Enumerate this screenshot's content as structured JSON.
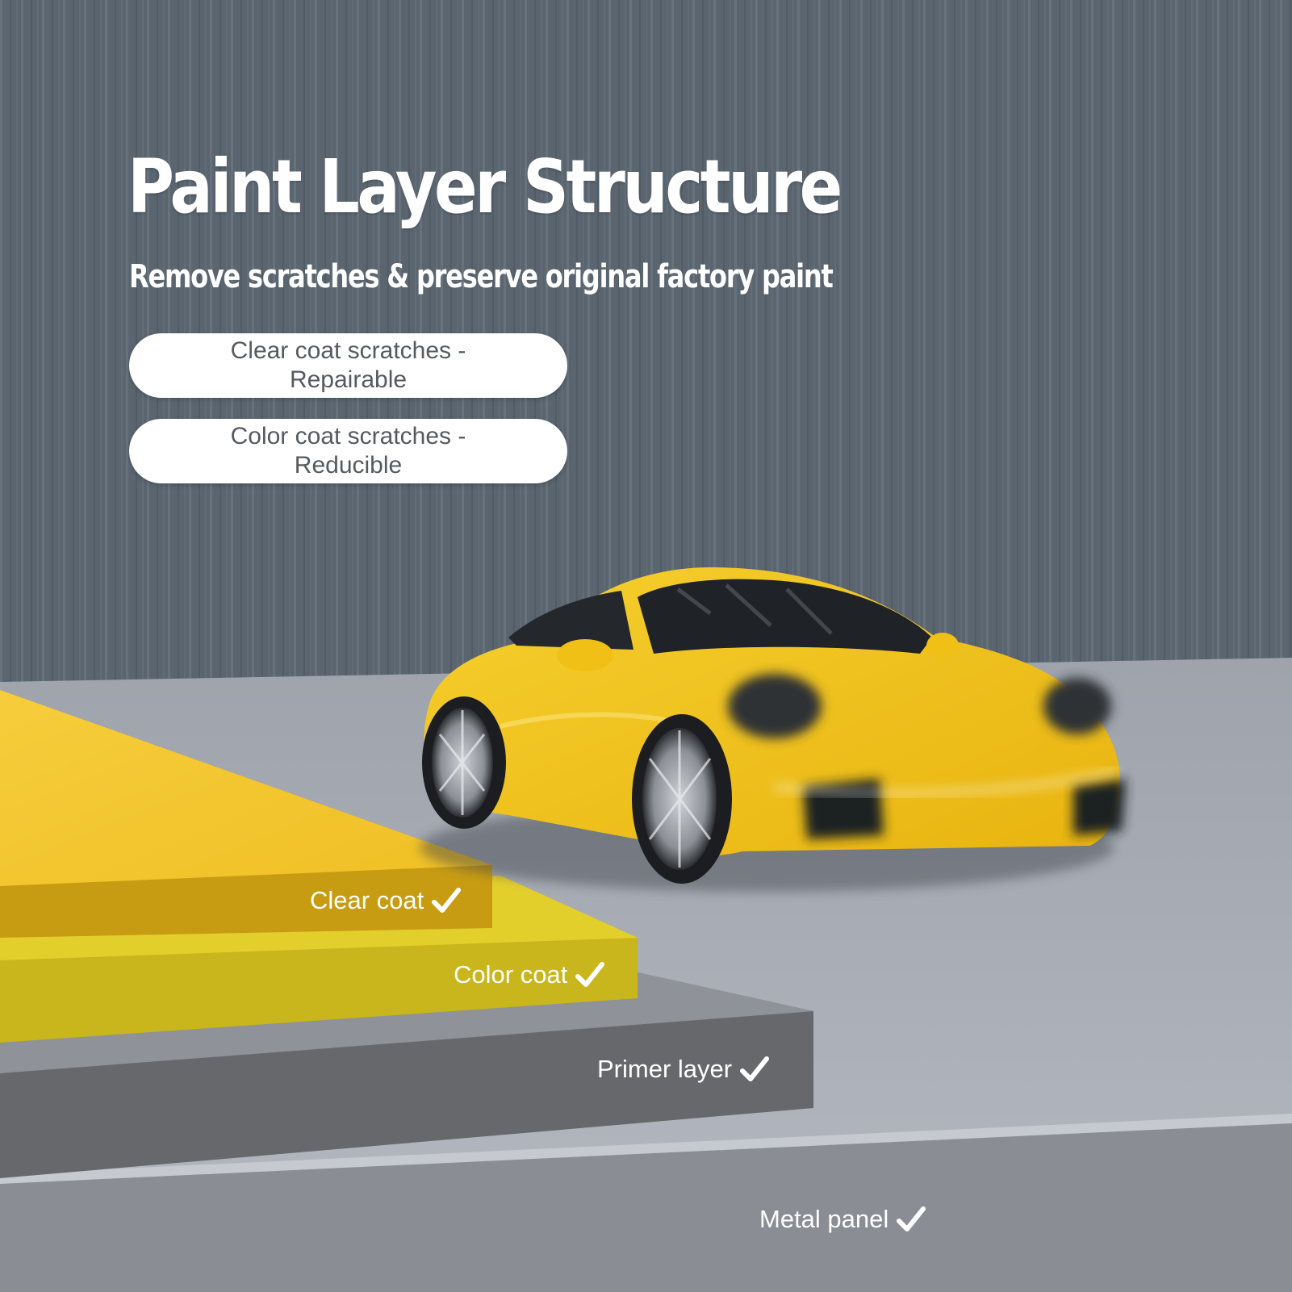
{
  "header": {
    "title": "Paint Layer Structure",
    "subtitle": "Remove scratches & preserve original factory paint"
  },
  "pills": [
    {
      "text": "Clear coat scratches - Repairable"
    },
    {
      "text": "Color coat scratches - Reducible"
    }
  ],
  "layers": [
    {
      "label": "Clear coat"
    },
    {
      "label": "Color coat"
    },
    {
      "label": "Primer layer"
    },
    {
      "label": "Metal panel"
    }
  ],
  "colors": {
    "wall": "#5f6b76",
    "floor": "#a9adb6",
    "clear_coat": "#f2c12a",
    "color_coat": "#d2bf1f",
    "primer": "#66686b",
    "metal": "#8a8d93",
    "car": "#f1c21c",
    "text": "#ffffff"
  },
  "icons": {
    "layer_check": "check-icon"
  }
}
